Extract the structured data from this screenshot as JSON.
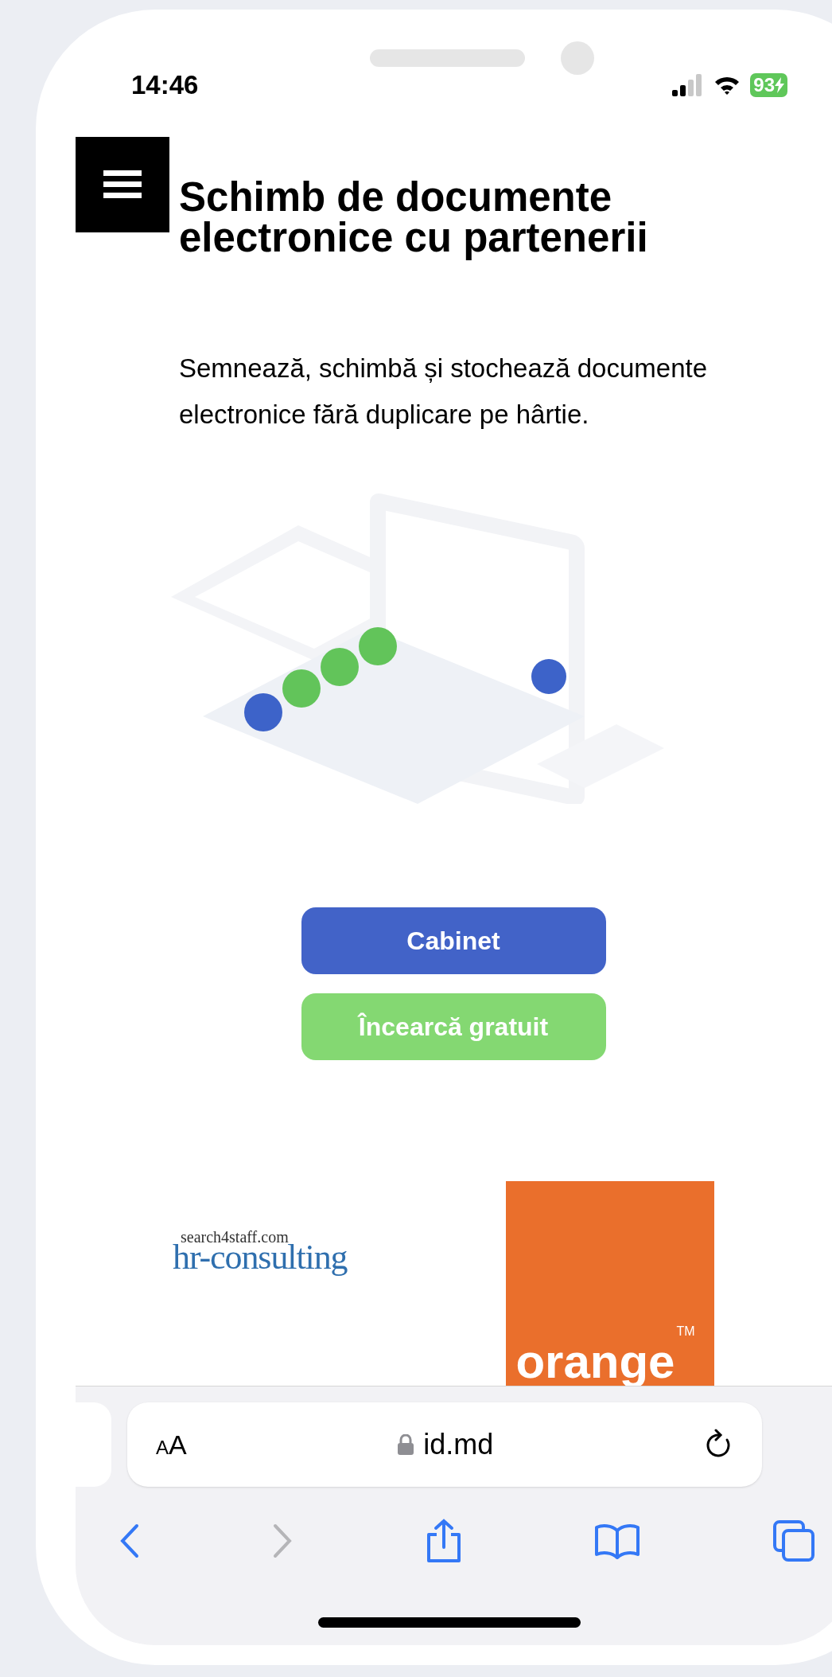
{
  "status_bar": {
    "time": "14:46",
    "battery": "93"
  },
  "page": {
    "title": "Schimb de documente electronice cu partenerii",
    "description": "Semnează, schimbă și stochează documente electronice fără duplicare pe hârtie.",
    "buttons": [
      {
        "label": "Cabinet",
        "kind": "primary"
      },
      {
        "label": "Încearcă gratuit",
        "kind": "secondary"
      }
    ],
    "partners": [
      {
        "kind": "hr",
        "tagline": "search4staff.com",
        "name": "hr-consulting"
      },
      {
        "kind": "orange",
        "name": "orange",
        "mark": "TM"
      }
    ]
  },
  "browser": {
    "text_size": "AA",
    "url": "id.md"
  }
}
